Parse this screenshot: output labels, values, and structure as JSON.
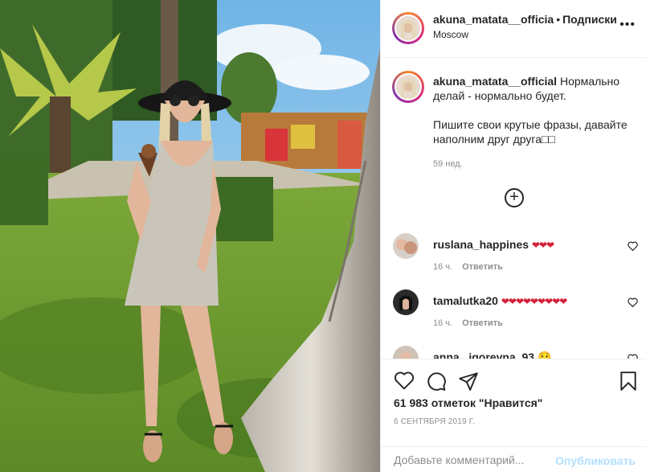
{
  "header": {
    "username": "akuna_matata__officia",
    "separator": "•",
    "follow_label": "Подписки",
    "location": "Moscow",
    "more_label": "•••"
  },
  "caption": {
    "username": "akuna_matata__official",
    "line1": "Нормально делай - нормально будет.",
    "line2": "Пишите свои крутые фразы, давайте наполним друг друга",
    "line2_glyphs": "□□",
    "time_ago": "59 нед.",
    "load_more_label": "+"
  },
  "comments": [
    {
      "username": "ruslana_happines",
      "text": "❤❤❤",
      "time": "16 ч.",
      "reply_label": "Ответить"
    },
    {
      "username": "tamalutka20",
      "text": "❤❤❤❤❤❤❤❤❤",
      "time": "16 ч.",
      "reply_label": "Ответить"
    },
    {
      "username": "anna._igorevna_93",
      "text": "😯"
    }
  ],
  "actions": {
    "likes_text": "61 983 отметок \"Нравится\"",
    "date": "6 СЕНТЯБРЯ 2019 Г."
  },
  "add_comment": {
    "placeholder": "Добавьте комментарий...",
    "publish_label": "Опубликовать"
  },
  "colors": {
    "text": "#262626",
    "muted": "#8e8e8e",
    "publish_disabled": "#b2dffc",
    "heart": "#d4203a"
  }
}
